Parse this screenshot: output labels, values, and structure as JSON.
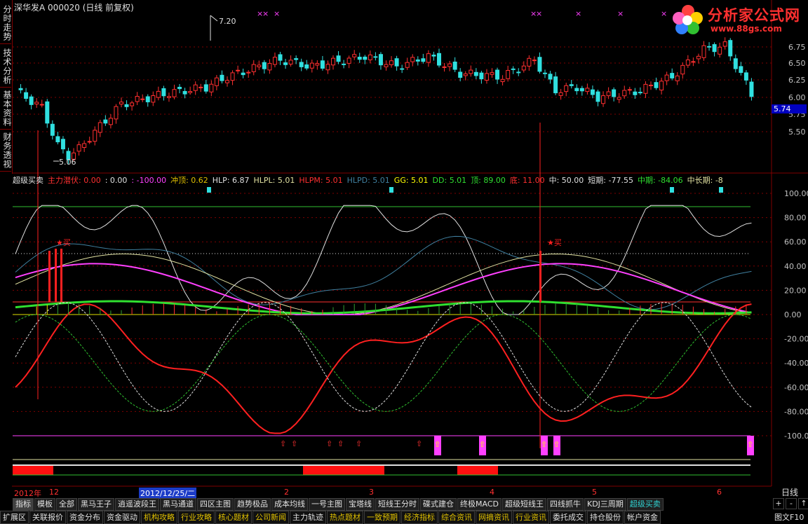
{
  "header": {
    "stock": "深华发A",
    "code": "000020",
    "mode": "(日线 前复权)"
  },
  "logo": {
    "brand": "分析家公式网",
    "url_text": "www.88gs.com"
  },
  "sidebar": {
    "tabs": [
      "分时走势",
      "技术分析",
      "基本资料",
      "财务透视"
    ]
  },
  "price_axis": {
    "labels": [
      "6.75",
      "6.50",
      "6.25",
      "6.00",
      "5.75",
      "5.50"
    ],
    "current": "5.74"
  },
  "price_marks": {
    "high": "7.20",
    "low": "5.06"
  },
  "indicator": {
    "name": "超级买卖",
    "items": [
      {
        "text": "主力潜伏: 0.00",
        "color": "#ff3030"
      },
      {
        "text": ": 0.00",
        "color": "#e0e0e0"
      },
      {
        "text": ": -100.00",
        "color": "#ff40ff"
      },
      {
        "text": "冲顶: 0.62",
        "color": "#e0c000"
      },
      {
        "text": "HLP: 6.87",
        "color": "#e0e0e0"
      },
      {
        "text": "HLPL: 5.01",
        "color": "#e0e0a0"
      },
      {
        "text": "HLPM: 5.01",
        "color": "#ff3030"
      },
      {
        "text": "HLPD: 5.01",
        "color": "#4080a0"
      },
      {
        "text": "GG: 5.01",
        "color": "#ffff00"
      },
      {
        "text": "DD: 5.01",
        "color": "#30e030"
      },
      {
        "text": "顶: 89.00",
        "color": "#30e030"
      },
      {
        "text": "底: 11.00",
        "color": "#ff3030"
      },
      {
        "text": "中: 50.00",
        "color": "#e0e0e0"
      },
      {
        "text": "短期: -77.55",
        "color": "#e0e0e0"
      },
      {
        "text": "中期: -84.06",
        "color": "#30e030"
      },
      {
        "text": "中长期: -8",
        "color": "#e0e0a0"
      }
    ]
  },
  "ind_axis": {
    "labels": [
      "100.00",
      "80.00",
      "60.00",
      "40.00",
      "20.00",
      "0.00",
      "-20.00",
      "-40.00",
      "-60.00",
      "-80.00",
      "-100.00"
    ]
  },
  "signals": {
    "buy": "买"
  },
  "date_bar": {
    "year": "2012年",
    "m12": "12",
    "selected": "2012/12/25/二",
    "m2": "2",
    "m3": "3",
    "m4": "4",
    "m5": "5",
    "m6": "6"
  },
  "period": "日线",
  "tabs1": [
    "指标",
    "模板",
    "全部",
    "黑马王子",
    "逍遥波段王",
    "黑马通道",
    "四区主图",
    "趋势极品",
    "成本均线",
    "一号主图",
    "宝塔线",
    "短线王分时",
    "碟式建仓",
    "终极MACD",
    "超级短线王",
    "四线抓牛",
    "KDJ三周期",
    "超级买卖"
  ],
  "tabs2": [
    {
      "label": "扩展区",
      "hl": false
    },
    {
      "label": "关联报价",
      "hl": false
    },
    {
      "label": "资金分布",
      "hl": false
    },
    {
      "label": "资金驱动",
      "hl": false
    },
    {
      "label": "机构攻略",
      "hl": true
    },
    {
      "label": "行业攻略",
      "hl": true
    },
    {
      "label": "核心题材",
      "hl": true
    },
    {
      "label": "公司新闻",
      "hl": true
    },
    {
      "label": "主力轨迹",
      "hl": false
    },
    {
      "label": "热点题材",
      "hl": true
    },
    {
      "label": "一致预期",
      "hl": true
    },
    {
      "label": "经济指标",
      "hl": true
    },
    {
      "label": "综合资讯",
      "hl": true
    },
    {
      "label": "网摘资讯",
      "hl": true
    },
    {
      "label": "行业资讯",
      "hl": true
    },
    {
      "label": "委托成交",
      "hl": false
    },
    {
      "label": "持仓股份",
      "hl": false
    },
    {
      "label": "帐户资金",
      "hl": false
    }
  ],
  "nav": {
    "plus": "+",
    "minus": "-",
    "up": "↑",
    "down": "↓"
  },
  "f10": "图文F10",
  "colors": {
    "up": "#ff3030",
    "down": "#30e0e0",
    "grid": "#800000"
  }
}
